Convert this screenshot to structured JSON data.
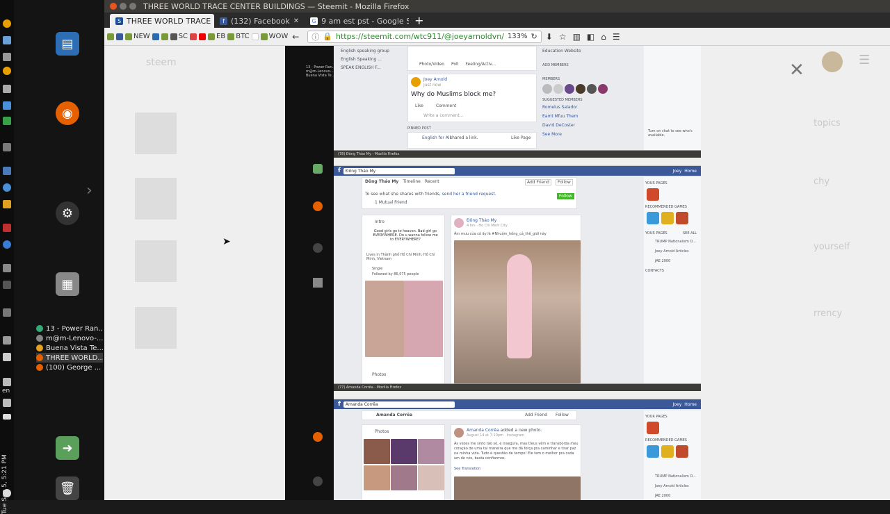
{
  "window": {
    "title": "THREE WORLD TRACE CENTER BUILDINGS — Steemit - Mozilla Firefox"
  },
  "tabs": [
    {
      "label": "THREE WORLD TRACE",
      "favicon": "steemit",
      "active": true
    },
    {
      "label": "(132) Facebook",
      "favicon": "facebook",
      "active": false
    },
    {
      "label": "9 am est pst - Google S",
      "favicon": "google",
      "active": false
    }
  ],
  "bookmarks": [
    "NEW",
    "SC",
    "EB",
    "BTC",
    "WOW"
  ],
  "url": {
    "value": "https://steemit.com/wtc911/@joeyarnoldvn/",
    "zoom": "133%"
  },
  "taskbar": {
    "items": [
      {
        "label": "13 - Power Ran...",
        "active": false
      },
      {
        "label": "m@m-Lenovo-...",
        "active": false
      },
      {
        "label": "Buena Vista Te...",
        "active": false
      },
      {
        "label": "THREE WORLD...",
        "active": true
      },
      {
        "label": "(100) George ...",
        "active": false
      }
    ],
    "lang": "en",
    "clock": "Tue Sep 5, 5:21 PM"
  },
  "background_page": {
    "ghost_texts": [
      "steem",
      "topics",
      "chy",
      "yourself",
      "rrency"
    ]
  },
  "screenshot": {
    "panel1": {
      "group_items": [
        "English speaking group",
        "English Speaking ...",
        "SPEAK ENGLISH F..."
      ],
      "post_author": "Joey Arnold",
      "post_sub": "Just now",
      "post_text": "Why do Muslims block me?",
      "like": "Like",
      "comment": "Comment",
      "write_comment": "Write a comment...",
      "pinned": "PINNED POST",
      "pinned_author": "English for All",
      "pinned_action": "shared a link.",
      "like_page": "Like Page",
      "photo_video": "Photo/Video",
      "poll": "Poll",
      "feeling": "Feeling/Activ...",
      "add_members": "ADD MEMBERS",
      "members": "MEMBERS",
      "suggested": "SUGGESTED MEMBERS",
      "suggested_people": [
        "Romelus Salador",
        "Eamt Mfuu Them",
        "David DeCoster"
      ],
      "add_member": "Add Member",
      "see_more": "See More",
      "edu_site": "Education Website",
      "chat_hint": "Turn on chat to see who's available."
    },
    "panel2": {
      "window_title": "(78) Đông Thảo My - Mozilla Firefox",
      "search_value": "Đông Thảo My",
      "profile_name": "Đông Thảo My",
      "timeline": "Timeline",
      "recent": "Recent",
      "add_friend": "Add Friend",
      "follow": "Follow",
      "see_prompt": "To see what she shares with friends,",
      "friend_request": "send her a friend request.",
      "mutual": "1 Mutual Friend",
      "intro": "Intro",
      "intro_text": "Good girls go to heaven. Bad girl go EVERYWHERE. Do u wanna follow me to EVERYWHERE?",
      "lives_in": "Lives in Thành phố Hồ Chí Minh, Hồ Chí Minh, Vietnam",
      "single": "Single",
      "followed": "Followed by 86,075 people",
      "photos": "Photos",
      "post_author": "Đông Thảo My",
      "post_meta": "4 hrs · Ho Chi Minh City",
      "post_text": "Âm mưu của cô ấy là #Nhuộm_hồng_cả_thế_giới này",
      "your_pages": "YOUR PAGES",
      "recommended_games": "RECOMMENDED GAMES",
      "pages": [
        "TRUMP Nationalism O...",
        "Joey Arnold Articles",
        "JAE 2000"
      ],
      "contacts": "CONTACTS",
      "see_all": "SEE ALL",
      "joey": "Joey",
      "home": "Home"
    },
    "panel3": {
      "window_title": "(77) Amanda Corrêa - Mozilla Firefox",
      "search_value": "Amanda Corrêa",
      "profile_name": "Amanda Corrêa",
      "photos": "Photos",
      "post_author": "Amanda Corrêa",
      "post_action": "added a new photo.",
      "post_meta": "August 14 at 7:10pm · Instagram",
      "post_text": "Às vezes me sinto tão só, e insegura, mas Deus vêm e transborda meu coração de uma tal maneira que me dá força pra caminhar e tirar paz na minha vida. Tudo é questão de tempo! Ele tem o melhor pra cada um de nós, basta confiarmos.",
      "see_translation": "See Translation"
    }
  },
  "colors": {
    "facebook_blue": "#3b5998",
    "firefox_titlebar": "#3c3b37",
    "dock": "#141414"
  }
}
